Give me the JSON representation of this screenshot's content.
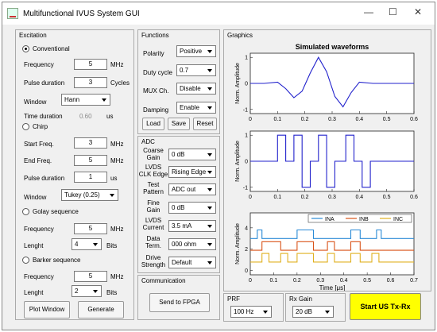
{
  "window": {
    "title": "Multifunctional IVUS System GUI",
    "minimize": "—",
    "maximize": "☐",
    "close": "✕"
  },
  "excitation": {
    "title": "Excitation",
    "conventional": {
      "label": "Conventional",
      "selected": true,
      "frequency_label": "Frequency",
      "frequency_value": "5",
      "frequency_unit": "MHz",
      "pulse_label": "Pulse duration",
      "pulse_value": "3",
      "pulse_unit": "Cycles",
      "window_label": "Window",
      "window_value": "Hann",
      "time_label": "Time duration",
      "time_value": "0.60",
      "time_unit": "us"
    },
    "chirp": {
      "label": "Chirp",
      "selected": false,
      "start_label": "Start Freq.",
      "start_value": "3",
      "start_unit": "MHz",
      "end_label": "End Freq.",
      "end_value": "5",
      "end_unit": "MHz",
      "pulse_label": "Pulse duration",
      "pulse_value": "1",
      "pulse_unit": "us",
      "window_label": "Window",
      "window_value": "Tukey (0.25)"
    },
    "golay": {
      "label": "Golay sequence",
      "selected": false,
      "freq_label": "Frequency",
      "freq_value": "5",
      "freq_unit": "MHz",
      "len_label": "Lenght",
      "len_value": "4",
      "len_unit": "Bits"
    },
    "barker": {
      "label": "Barker sequence",
      "selected": false,
      "freq_label": "Frequency",
      "freq_value": "5",
      "freq_unit": "MHz",
      "len_label": "Lenght",
      "len_value": "2",
      "len_unit": "Bits"
    },
    "plot_button": "Plot Window",
    "generate_button": "Generate"
  },
  "functions": {
    "title": "Functions",
    "polarity_label": "Polarity",
    "polarity_value": "Positive",
    "duty_label": "Duty cycle",
    "duty_value": "0.7",
    "mux_label": "MUX Ch.",
    "mux_value": "Disable",
    "damping_label": "Damping",
    "damping_value": "Enable",
    "load_button": "Load",
    "save_button": "Save",
    "reset_button": "Reset"
  },
  "adc": {
    "title": "ADC",
    "coarse_label": "Coarse Gain",
    "coarse_value": "0 dB",
    "lvds_label": "LVDS CLK Edge",
    "lvds_value": "Rising Edge",
    "test_label": "Test Pattern",
    "test_value": "ADC out",
    "fine_label": "Fine Gain",
    "fine_value": "0 dB",
    "lvds_current_label": "LVDS Current",
    "lvds_current_value": "3.5 mA",
    "term_label": "Data Term.",
    "term_value": "000 ohm",
    "drive_label": "Drive Strength",
    "drive_value": "Default"
  },
  "communication": {
    "title": "Communication",
    "send_button": "Send to FPGA"
  },
  "graphics": {
    "title": "Graphics"
  },
  "prf": {
    "title": "PRF",
    "value": "100 Hz"
  },
  "rx_gain": {
    "title": "Rx Gain",
    "value": "20 dB"
  },
  "start_button": {
    "label": "Start US Tx-Rx",
    "color": "#ffff00"
  },
  "chart_data": [
    {
      "type": "line",
      "title": "Simulated waveforms",
      "ylabel": "Norm. Amplitude",
      "xlabel": "",
      "xlim": [
        0,
        0.6
      ],
      "ylim": [
        -1,
        1
      ],
      "x_ticks": [
        "0",
        "0.1",
        "0.2",
        "0.3",
        "0.4",
        "0.5",
        "0.6"
      ],
      "y_ticks": [
        "1",
        "0",
        "-1"
      ],
      "series": [
        {
          "color": "#2222cc",
          "x": [
            0,
            0.05,
            0.1,
            0.13,
            0.16,
            0.19,
            0.22,
            0.25,
            0.28,
            0.31,
            0.34,
            0.37,
            0.4,
            0.45,
            0.5,
            0.55,
            0.6
          ],
          "y": [
            0,
            0,
            0.05,
            -0.2,
            -0.55,
            -0.3,
            0.4,
            1.0,
            0.45,
            -0.5,
            -0.9,
            -0.35,
            0.05,
            0.0,
            0,
            0,
            0
          ]
        }
      ]
    },
    {
      "type": "line",
      "title": "",
      "ylabel": "Norm. Amplitude",
      "xlabel": "",
      "xlim": [
        0,
        0.6
      ],
      "ylim": [
        -1,
        1
      ],
      "x_ticks": [
        "0",
        "0.1",
        "0.2",
        "0.3",
        "0.4",
        "0.5",
        "0.6"
      ],
      "y_ticks": [
        "1",
        "0",
        "-1"
      ],
      "series": [
        {
          "color": "#2222cc",
          "x": [
            0,
            0.03,
            0.03,
            0.1,
            0.1,
            0.13,
            0.13,
            0.16,
            0.16,
            0.19,
            0.19,
            0.22,
            0.22,
            0.25,
            0.25,
            0.28,
            0.28,
            0.31,
            0.31,
            0.35,
            0.35,
            0.38,
            0.38,
            0.41,
            0.41,
            0.44,
            0.44,
            0.47,
            0.47,
            0.6
          ],
          "y": [
            0,
            0,
            0,
            0,
            1,
            1,
            0,
            0,
            1,
            1,
            -1,
            -1,
            0,
            0,
            1,
            1,
            -1,
            -1,
            0,
            0,
            1,
            1,
            0,
            0,
            -1,
            -1,
            0,
            0,
            0,
            0
          ]
        }
      ]
    },
    {
      "type": "line",
      "title": "",
      "ylabel": "Norm. Amplitude",
      "xlabel": "Time [μs]",
      "xlim": [
        0,
        0.7
      ],
      "ylim": [
        0,
        5
      ],
      "x_ticks": [
        "0",
        "0.1",
        "0.2",
        "0.3",
        "0.4",
        "0.5",
        "0.6",
        "0.7"
      ],
      "y_ticks": [
        "4",
        "2",
        "0"
      ],
      "legend": [
        "INA",
        "INB",
        "INC"
      ],
      "legend_position": "top-right",
      "series": [
        {
          "name": "INA",
          "color": "#2a8ad6",
          "x": [
            0,
            0.03,
            0.03,
            0.05,
            0.05,
            0.2,
            0.2,
            0.27,
            0.27,
            0.43,
            0.43,
            0.47,
            0.47,
            0.54,
            0.54,
            0.56,
            0.56,
            0.7
          ],
          "y": [
            3,
            3,
            3.8,
            3.8,
            3,
            3,
            3.8,
            3.8,
            3,
            3,
            3.8,
            3.8,
            3,
            3,
            3.8,
            3.8,
            3,
            3
          ]
        },
        {
          "name": "INB",
          "color": "#d95319",
          "x": [
            0,
            0.05,
            0.05,
            0.13,
            0.13,
            0.2,
            0.2,
            0.27,
            0.27,
            0.33,
            0.33,
            0.36,
            0.36,
            0.43,
            0.43,
            0.47,
            0.47,
            0.55,
            0.55,
            0.7
          ],
          "y": [
            1.9,
            1.9,
            2.7,
            2.7,
            1.9,
            1.9,
            2.7,
            2.7,
            1.9,
            1.9,
            2.7,
            2.7,
            1.9,
            1.9,
            2.7,
            2.7,
            1.9,
            1.9,
            1.9,
            1.9
          ]
        },
        {
          "name": "INC",
          "color": "#e0b020",
          "x": [
            0,
            0.05,
            0.05,
            0.08,
            0.08,
            0.13,
            0.13,
            0.16,
            0.16,
            0.2,
            0.2,
            0.27,
            0.27,
            0.33,
            0.33,
            0.36,
            0.36,
            0.43,
            0.43,
            0.47,
            0.47,
            0.52,
            0.52,
            0.55,
            0.55,
            0.7
          ],
          "y": [
            0.8,
            0.8,
            1.6,
            1.6,
            0.8,
            0.8,
            1.6,
            1.6,
            0.8,
            0.8,
            1.6,
            1.6,
            0.8,
            0.8,
            1.6,
            1.6,
            0.8,
            0.8,
            1.6,
            1.6,
            0.8,
            0.8,
            1.6,
            1.6,
            0.8,
            0.8
          ]
        }
      ]
    }
  ]
}
